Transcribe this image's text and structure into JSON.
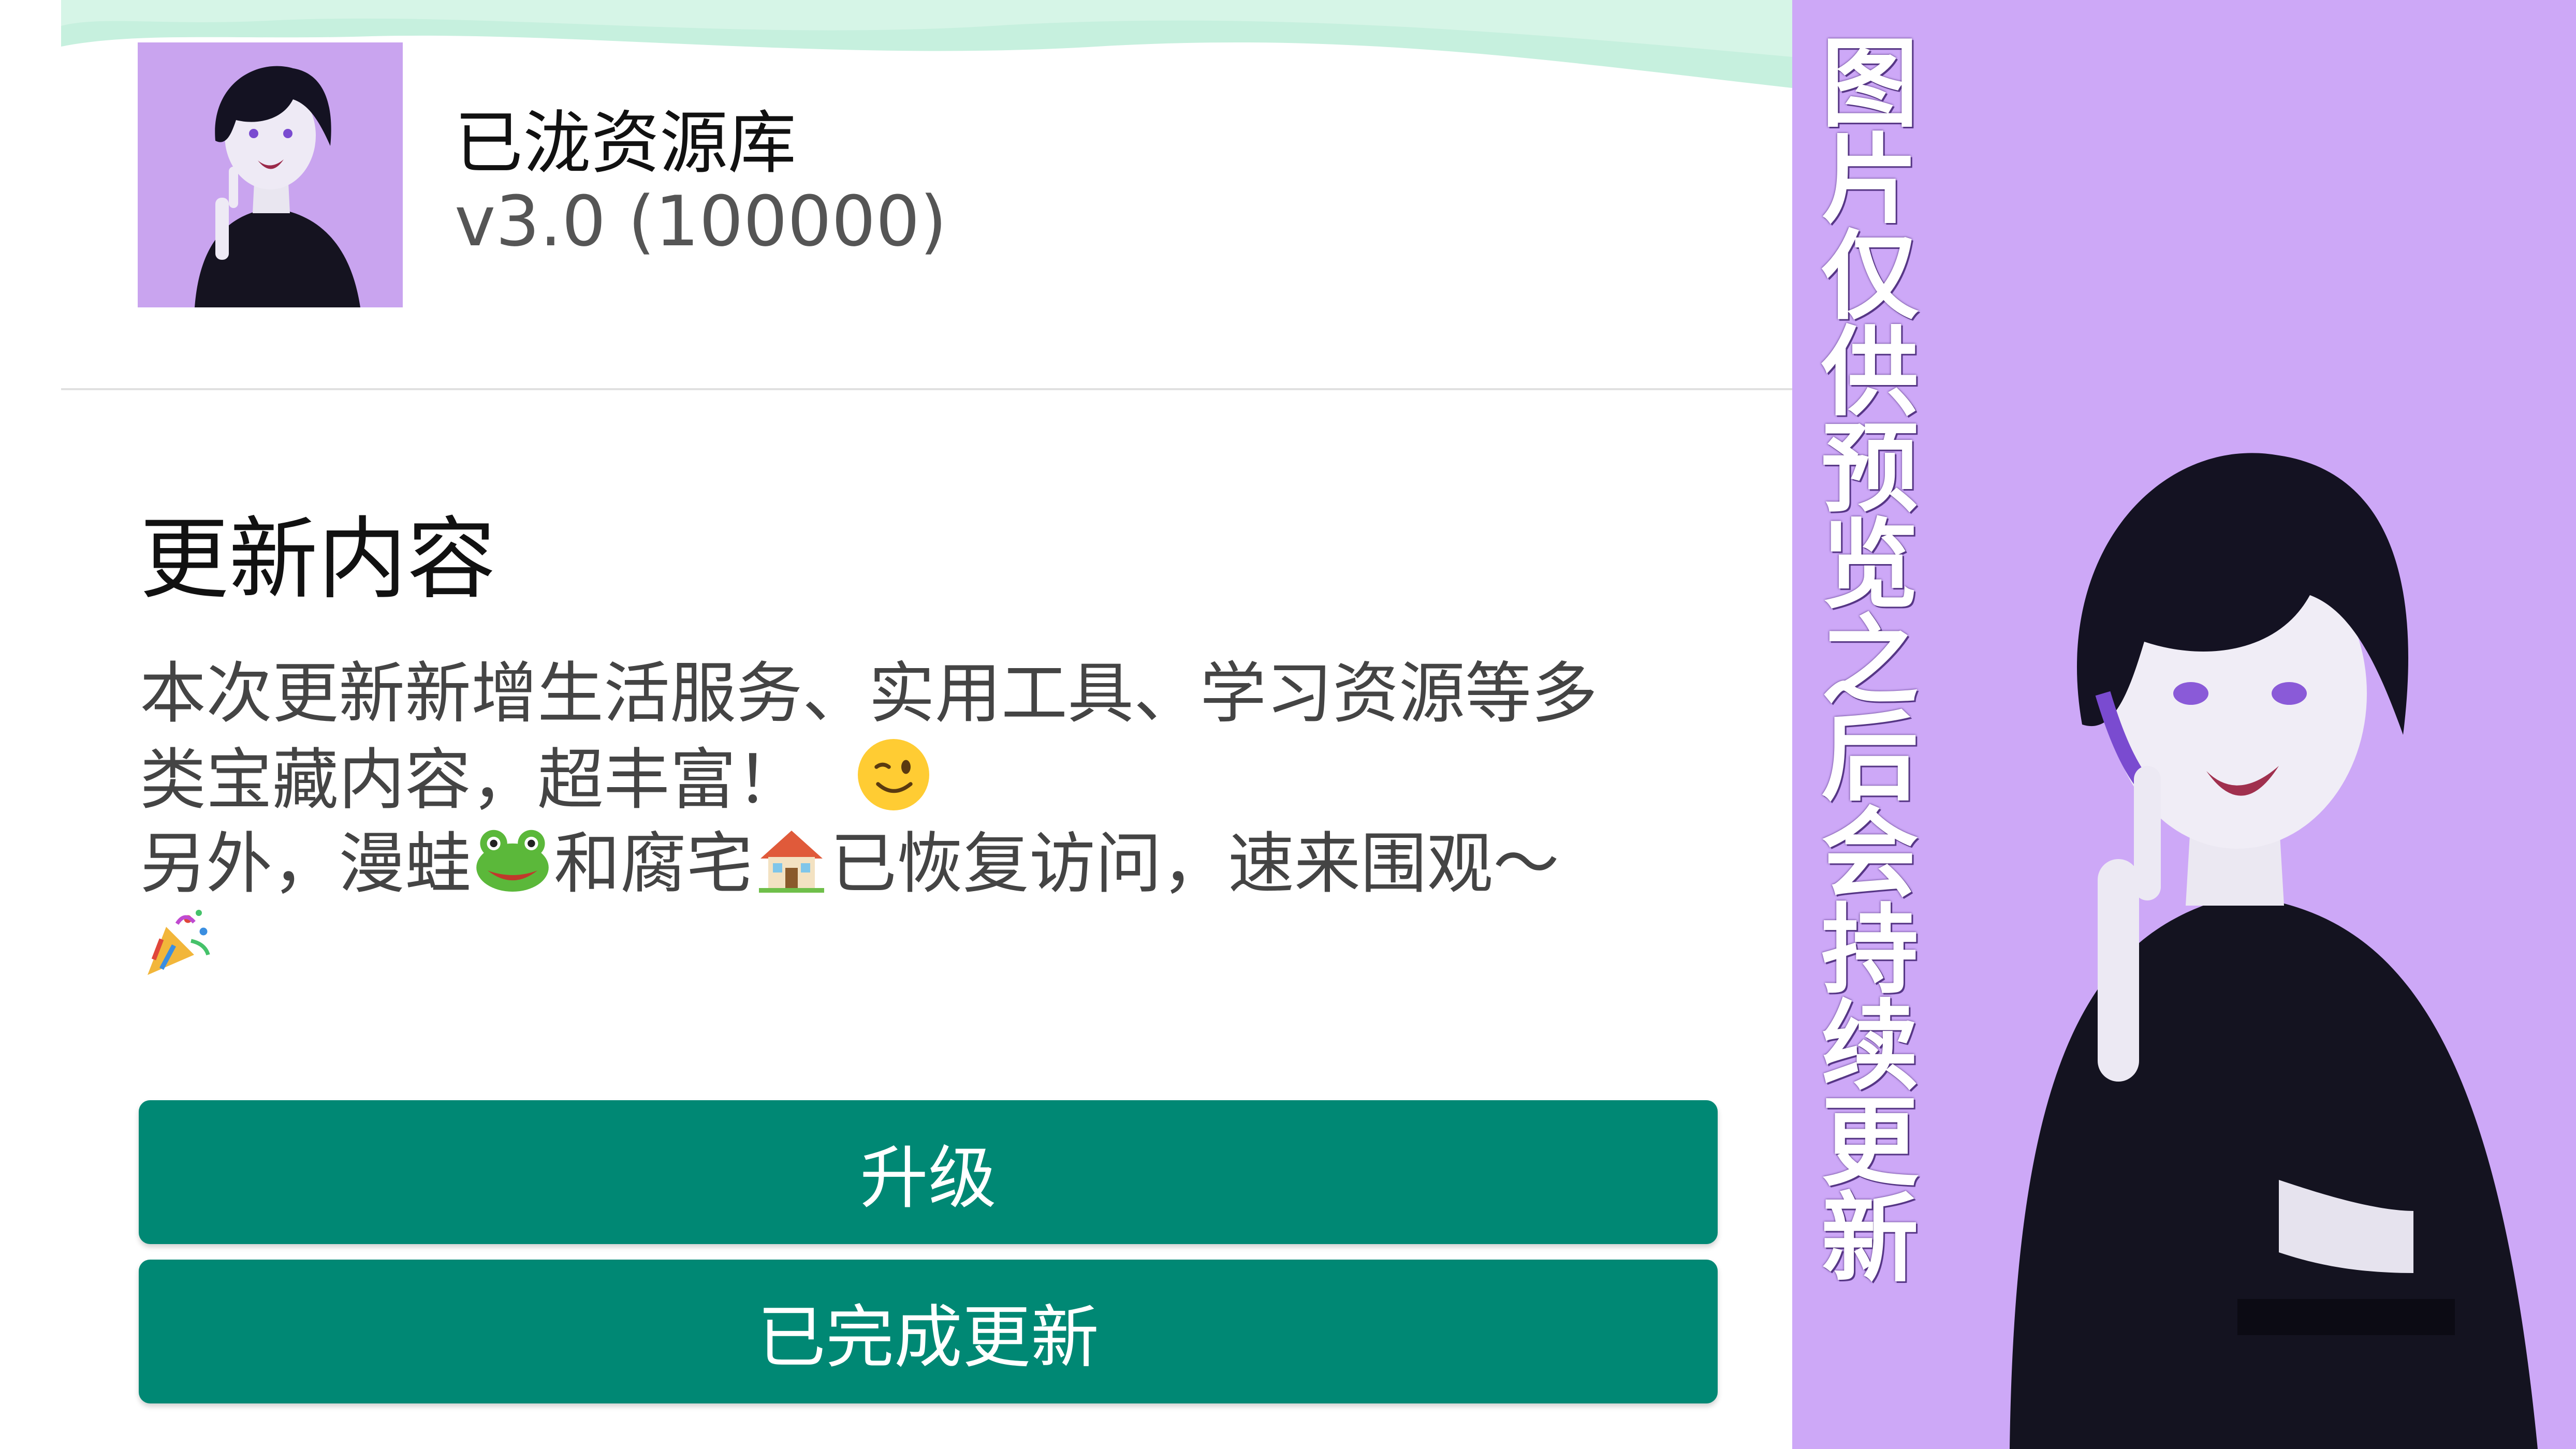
{
  "app": {
    "name": "已泷资源库",
    "version": "v3.0 (100000)"
  },
  "update": {
    "section_title": "更新内容",
    "lines": [
      "本次更新新增生活服务、实用工具、学习资源等多",
      "类宝藏内容，超丰富！",
      "另外，漫蛙",
      "和腐宅",
      "已恢复访问，速来围观～"
    ]
  },
  "buttons": {
    "upgrade_label": "升级",
    "done_label": "已完成更新"
  },
  "promo": {
    "vertical_text": "图片仅供预览之后会持续更新"
  },
  "icons": {
    "wink": "winking-face-icon",
    "frog": "frog-icon",
    "house": "house-icon",
    "party": "party-popper-icon"
  },
  "colors": {
    "button": "#008874",
    "promo_bg": "#cda8f7",
    "header_wave": "#c6f0de",
    "icon_bg": "#c9a4ef"
  }
}
